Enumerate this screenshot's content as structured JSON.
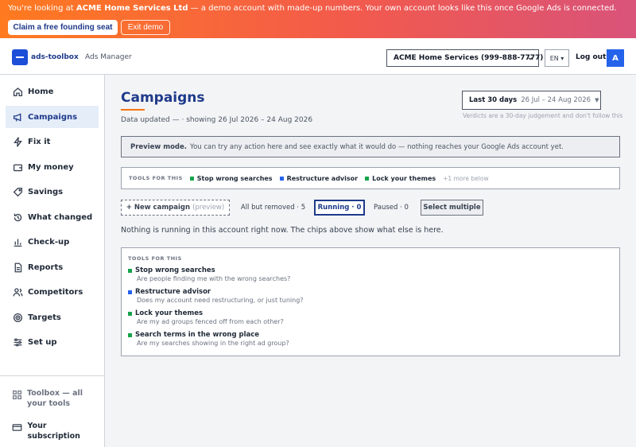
{
  "banner": {
    "prefix": "You're looking at ",
    "account": "ACME Home Services Ltd",
    "suffix": " — a demo account with made-up numbers. Your own account looks like this once Google Ads is connected.",
    "claim_label": "Claim a free founding seat",
    "exit_label": "Exit demo"
  },
  "topnav": {
    "logo_text": "ads-toolbox",
    "app_name": "Ads Manager",
    "account_selected": "ACME Home Services (999-888-7777)",
    "lang": "EN ▾",
    "logout_label": "Log out",
    "avatar_initial": "A"
  },
  "sidebar": {
    "items": [
      {
        "label": "Home",
        "icon": "home-icon"
      },
      {
        "label": "Campaigns",
        "icon": "megaphone-icon"
      },
      {
        "label": "Fix it",
        "icon": "bolt-icon"
      },
      {
        "label": "My money",
        "icon": "wallet-icon"
      },
      {
        "label": "Savings",
        "icon": "tag-icon"
      },
      {
        "label": "What changed",
        "icon": "history-icon"
      },
      {
        "label": "Check-up",
        "icon": "bar-chart-icon"
      },
      {
        "label": "Reports",
        "icon": "document-icon"
      },
      {
        "label": "Competitors",
        "icon": "users-icon"
      },
      {
        "label": "Targets",
        "icon": "target-icon"
      },
      {
        "label": "Set up",
        "icon": "sliders-icon"
      }
    ],
    "active_item": "Campaigns",
    "toolbox_label": "Toolbox — all your tools",
    "subscription_label": "Your subscription"
  },
  "main": {
    "title": "Campaigns",
    "subline": "Data updated — · showing 26 Jul 2026 – 24 Aug 2026",
    "date_label": "Last 30 days",
    "date_range": "26 Jul – 24 Aug 2026",
    "verdict_note": "Verdicts are a 30-day judgement and don't follow this",
    "preview_strong": "Preview mode.",
    "preview_text": "You can try any action here and see exactly what it would do — nothing reaches your Google Ads account yet.",
    "tools_label": "TOOLS FOR THIS",
    "strip_tools": [
      {
        "label": "Stop wrong searches",
        "color": "#16a34a"
      },
      {
        "label": "Restructure advisor",
        "color": "#2563eb"
      },
      {
        "label": "Lock your themes",
        "color": "#16a34a"
      }
    ],
    "more_below": "+1 more below",
    "chips": {
      "new_campaign": "+ New campaign",
      "new_campaign_note": "(preview)",
      "all_but_removed": "All but removed · 5",
      "running": "Running · 0",
      "paused": "Paused · 0",
      "select_multiple": "Select multiple"
    },
    "empty_message": "Nothing is running in this account right now. The chips above show what else is here.",
    "tools_list": [
      {
        "name": "Stop wrong searches",
        "desc": "Are people finding me with the wrong searches?",
        "color": "#16a34a"
      },
      {
        "name": "Restructure advisor",
        "desc": "Does my account need restructuring, or just tuning?",
        "color": "#2563eb"
      },
      {
        "name": "Lock your themes",
        "desc": "Are my ad groups fenced off from each other?",
        "color": "#16a34a"
      },
      {
        "name": "Search terms in the wrong place",
        "desc": "Are my searches showing in the right ad group?",
        "color": "#16a34a"
      }
    ]
  }
}
